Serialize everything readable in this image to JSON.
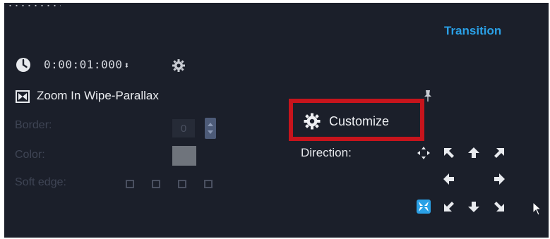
{
  "panel": {
    "tab_title": "Transition"
  },
  "duration": {
    "value": "0:00:01:000",
    "spinner_glyph": "⬍",
    "clock_icon": "clock-icon",
    "settings_icon": "settings-gear-icon"
  },
  "effect": {
    "title": "Zoom In Wipe-Parallax",
    "icon": "transition-effect-icon"
  },
  "properties": {
    "border_label": "Border:",
    "border_value": "0",
    "color_label": "Color:",
    "color_value": "#6f747c",
    "soft_edge_label": "Soft edge:",
    "soft_edge_options": [
      "none",
      "low",
      "medium",
      "high"
    ]
  },
  "customize": {
    "label": "Customize",
    "icon": "gear-icon",
    "highlight_color": "#c7141c"
  },
  "direction": {
    "label": "Direction:",
    "selected": "center-x",
    "options": [
      "center-out",
      "up-left",
      "up",
      "up-right",
      "left",
      "right",
      "center-x",
      "down-left",
      "down",
      "down-right"
    ]
  },
  "colors": {
    "background": "#1b1f2a",
    "accent": "#2aa0e6",
    "text": "#e8eaee",
    "disabled_text": "#3f4555"
  }
}
